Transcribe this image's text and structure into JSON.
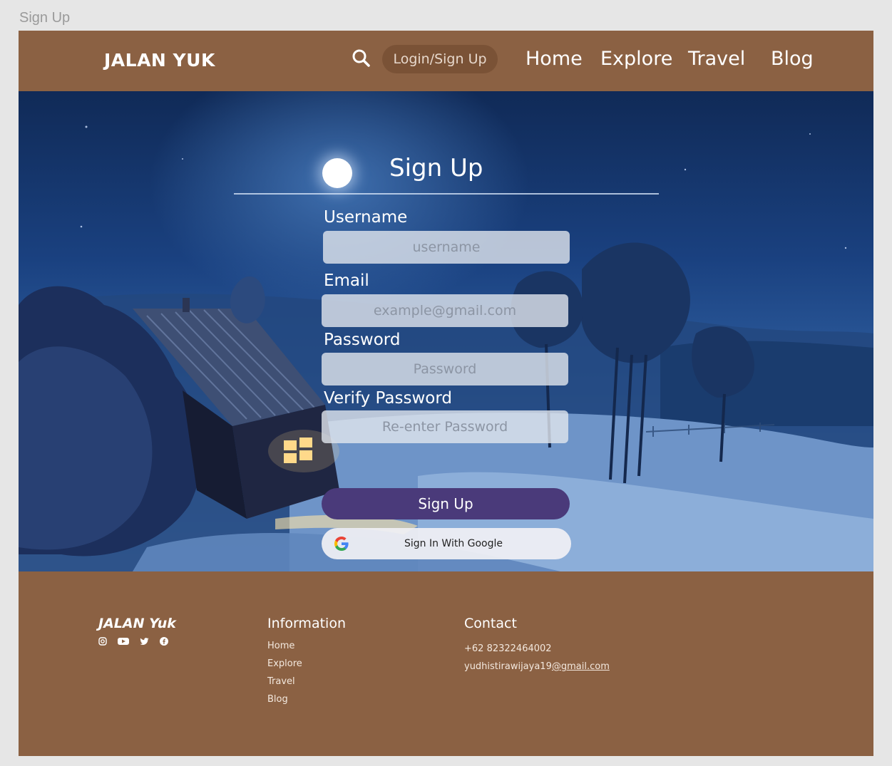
{
  "frame_label": "Sign Up",
  "header": {
    "logo": "JALAN YUK",
    "login_label": "Login/Sign Up",
    "nav": [
      "Home",
      "Explore",
      "Travel",
      "Blog"
    ]
  },
  "form": {
    "title": "Sign Up",
    "username_label": "Username",
    "username_placeholder": "username",
    "email_label": "Email",
    "email_placeholder": "example@gmail.com",
    "password_label": "Password",
    "password_placeholder": "Password",
    "verify_label": "Verify Password",
    "verify_placeholder": "Re-enter Password",
    "submit_label": "Sign Up",
    "google_label": "Sign In With Google"
  },
  "footer": {
    "brand": "JALAN Yuk",
    "social": [
      "instagram-icon",
      "youtube-icon",
      "twitter-icon",
      "facebook-icon"
    ],
    "info_heading": "Information",
    "info_links": [
      "Home",
      "Explore",
      "Travel",
      "Blog"
    ],
    "contact_heading": "Contact",
    "phone": "+62 82322464002",
    "email_user": "yudhistirawijaya19",
    "email_domain": "@gmail.com"
  },
  "colors": {
    "brand_brown": "#8b6143",
    "pill_brown": "#7a5236",
    "button_purple": "#4a3a7a"
  }
}
